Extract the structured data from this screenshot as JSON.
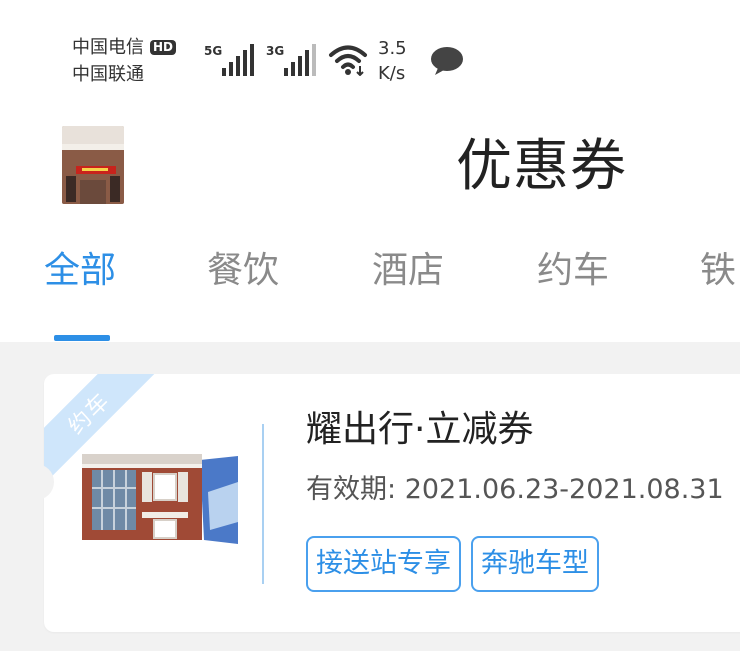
{
  "status_bar": {
    "carrier_1": "中国电信",
    "hd_badge": "HD",
    "carrier_2": "中国联通",
    "signal_1_type": "5G",
    "signal_2_type": "3G",
    "speed_value": "3.5",
    "speed_unit": "K/s",
    "icons": [
      "signal-5g-icon",
      "signal-3g-icon",
      "wifi-icon",
      "message-icon"
    ]
  },
  "header": {
    "title": "优惠券",
    "back_icon": "back-thumbnail-icon"
  },
  "tabs": {
    "items": [
      {
        "label": "全部",
        "active": true
      },
      {
        "label": "餐饮",
        "active": false
      },
      {
        "label": "酒店",
        "active": false
      },
      {
        "label": "约车",
        "active": false
      },
      {
        "label": "铁",
        "active": false
      }
    ]
  },
  "coupon": {
    "category_tag": "约车",
    "title": "耀出行·立减券",
    "validity_label": "有效期:",
    "validity_range": "2021.06.23-2021.08.31",
    "tags": [
      "接送站专享",
      "奔驰车型"
    ]
  },
  "colors": {
    "accent": "#2d8fe6",
    "ribbon": "#cfe6fb",
    "background": "#f2f2f2",
    "divider": "#a9d0f2"
  }
}
